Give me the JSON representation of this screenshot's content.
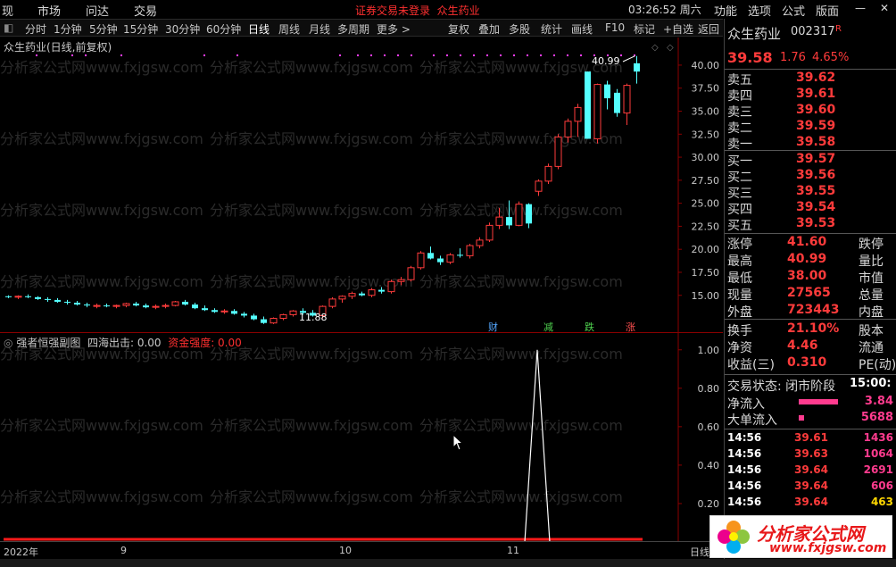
{
  "menubar": {
    "items": [
      "现",
      "市场",
      "问达",
      "交易"
    ],
    "status_warning": "证券交易未登录",
    "stock_name": "众生药业",
    "time": "03:26:52 周六",
    "right_items": [
      "功能",
      "选项",
      "公式",
      "版面"
    ]
  },
  "toolbar": {
    "items": [
      "分时",
      "1分钟",
      "5分钟",
      "15分钟",
      "30分钟",
      "60分钟",
      "日线",
      "周线",
      "月线",
      "多周期",
      "更多 >"
    ],
    "active": "日线",
    "right_items": [
      "复权",
      "叠加",
      "多股",
      "统计",
      "画线",
      "F10",
      "标记",
      "+自选",
      "返回"
    ]
  },
  "main_chart": {
    "title": "众生药业(日线,前复权)",
    "high_label": "40.99",
    "low_label": "11.88",
    "event_badges": [
      "财",
      "减",
      "跌",
      "涨"
    ]
  },
  "sub_chart": {
    "title": "强者恒强副图",
    "indicator1": "四海出击: 0.00",
    "indicator2": "资金强度: 0.00"
  },
  "date_axis": {
    "labels": [
      "2022年",
      "9",
      "10",
      "11"
    ],
    "period": "日线"
  },
  "watermark": "分析家公式网www.fxjgsw.com",
  "chart_data": [
    {
      "type": "candlestick",
      "title": "众生药业(日线,前复权)",
      "ylim": [
        11,
        43
      ],
      "y_ticks": [
        "40.00",
        "37.50",
        "35.00",
        "32.50",
        "30.00",
        "27.50",
        "25.00",
        "22.50",
        "20.00",
        "17.50",
        "15.00"
      ],
      "y_tick_values": [
        40,
        37.5,
        35,
        32.5,
        30,
        27.5,
        25,
        22.5,
        20,
        17.5,
        15
      ],
      "candles": [
        [
          14.9,
          15.0,
          14.7,
          14.8
        ],
        [
          14.8,
          15.0,
          14.6,
          14.9
        ],
        [
          14.9,
          15.1,
          14.7,
          14.8
        ],
        [
          14.8,
          14.9,
          14.5,
          14.6
        ],
        [
          14.6,
          14.8,
          14.3,
          14.5
        ],
        [
          14.5,
          14.7,
          14.2,
          14.3
        ],
        [
          14.3,
          14.5,
          14.0,
          14.2
        ],
        [
          14.2,
          14.4,
          13.9,
          14.0
        ],
        [
          14.0,
          14.2,
          13.7,
          13.9
        ],
        [
          13.8,
          14.1,
          13.6,
          13.9
        ],
        [
          13.9,
          14.1,
          13.7,
          13.8
        ],
        [
          13.8,
          14.0,
          13.6,
          13.9
        ],
        [
          13.9,
          14.2,
          13.7,
          14.1
        ],
        [
          14.1,
          14.3,
          13.8,
          13.9
        ],
        [
          13.9,
          14.1,
          13.6,
          13.7
        ],
        [
          13.7,
          14.0,
          13.5,
          13.8
        ],
        [
          13.8,
          14.1,
          13.6,
          13.9
        ],
        [
          13.9,
          14.4,
          13.8,
          14.3
        ],
        [
          14.3,
          14.5,
          13.9,
          14.0
        ],
        [
          14.0,
          14.2,
          13.5,
          13.6
        ],
        [
          13.6,
          13.9,
          13.3,
          13.4
        ],
        [
          13.4,
          13.6,
          13.1,
          13.2
        ],
        [
          13.2,
          13.5,
          13.0,
          13.3
        ],
        [
          13.3,
          13.5,
          12.9,
          13.0
        ],
        [
          13.0,
          13.2,
          12.6,
          12.8
        ],
        [
          12.8,
          13.0,
          12.3,
          12.4
        ],
        [
          12.4,
          12.7,
          11.9,
          12.0
        ],
        [
          12.0,
          12.6,
          11.88,
          12.5
        ],
        [
          12.5,
          13.0,
          12.3,
          12.9
        ],
        [
          12.9,
          13.4,
          12.7,
          13.3
        ],
        [
          13.3,
          13.6,
          12.9,
          13.1
        ],
        [
          13.1,
          13.4,
          12.7,
          12.8
        ],
        [
          12.8,
          13.9,
          12.5,
          13.8
        ],
        [
          13.8,
          14.8,
          13.6,
          14.6
        ],
        [
          14.6,
          15.0,
          14.2,
          14.9
        ],
        [
          14.9,
          15.4,
          14.6,
          15.2
        ],
        [
          15.2,
          15.4,
          14.9,
          15.0
        ],
        [
          15.0,
          15.8,
          14.8,
          15.6
        ],
        [
          15.6,
          15.9,
          15.2,
          15.4
        ],
        [
          15.4,
          16.7,
          15.2,
          16.5
        ],
        [
          16.5,
          17.0,
          16.1,
          16.7
        ],
        [
          16.7,
          18.2,
          16.5,
          18.0
        ],
        [
          18.0,
          19.8,
          17.8,
          19.6
        ],
        [
          19.6,
          20.3,
          18.9,
          19.0
        ],
        [
          19.0,
          19.3,
          18.3,
          18.6
        ],
        [
          18.6,
          19.6,
          18.4,
          19.4
        ],
        [
          19.4,
          20.1,
          19.1,
          19.3
        ],
        [
          19.3,
          20.6,
          19.0,
          20.4
        ],
        [
          20.4,
          21.3,
          20.1,
          21.0
        ],
        [
          21.0,
          22.9,
          20.8,
          22.6
        ],
        [
          22.6,
          24.5,
          22.2,
          23.5
        ],
        [
          23.5,
          25.3,
          22.2,
          22.6
        ],
        [
          22.6,
          25.2,
          22.5,
          24.9
        ],
        [
          24.9,
          25.0,
          22.3,
          22.8
        ],
        [
          26.3,
          27.6,
          25.8,
          27.4
        ],
        [
          27.4,
          29.3,
          27.1,
          29.0
        ],
        [
          29.0,
          32.5,
          28.7,
          32.2
        ],
        [
          32.2,
          34.2,
          31.6,
          33.9
        ],
        [
          33.9,
          35.8,
          32.2,
          35.4
        ],
        [
          39.3,
          39.3,
          32.0,
          32.0
        ],
        [
          32.0,
          38.0,
          31.5,
          37.9
        ],
        [
          37.9,
          38.3,
          35.2,
          36.4
        ],
        [
          37.0,
          37.4,
          34.4,
          34.8
        ],
        [
          34.8,
          38.0,
          33.5,
          37.8
        ],
        [
          40.2,
          40.99,
          38.0,
          39.3
        ]
      ]
    },
    {
      "type": "line",
      "title": "强者恒强副图",
      "series": [
        {
          "name": "四海出击",
          "values": [
            0,
            0,
            0,
            0,
            0,
            0,
            0,
            0,
            0,
            0,
            0,
            0,
            0,
            0,
            0,
            0,
            0,
            0,
            0,
            0,
            0,
            0,
            0,
            0,
            0,
            0,
            0,
            0,
            0,
            0,
            0,
            0,
            0,
            0,
            0,
            0,
            0,
            0,
            0,
            0,
            0,
            0,
            0,
            0,
            0,
            0,
            0,
            0,
            0,
            0,
            0,
            0,
            0,
            0,
            0,
            0,
            0,
            0,
            0,
            0,
            0,
            0,
            0,
            0,
            0
          ]
        },
        {
          "name": "资金强度",
          "values": [
            0,
            0,
            0,
            0,
            0,
            0,
            0,
            0,
            0,
            0,
            0,
            0,
            0,
            0,
            0,
            0,
            0,
            0,
            0,
            0,
            0,
            0,
            0,
            0,
            0,
            0,
            0,
            0,
            0,
            0,
            0,
            0,
            0,
            0,
            0,
            0,
            0,
            0,
            0,
            0,
            0,
            0,
            0,
            0,
            0,
            0,
            0,
            0,
            0,
            0,
            0,
            0,
            0,
            0,
            0,
            0,
            0,
            0,
            0,
            0,
            0,
            0,
            0,
            0,
            0
          ]
        }
      ],
      "spike": {
        "x_date": "2022-11",
        "value": 1.0
      },
      "ylim": [
        0,
        1.05
      ],
      "y_ticks": [
        "1.00",
        "0.80",
        "0.60",
        "0.40",
        "0.20"
      ],
      "y_tick_values": [
        1.0,
        0.8,
        0.6,
        0.4,
        0.2
      ]
    }
  ],
  "quote": {
    "name": "众生药业",
    "code": "002317",
    "flag": "R",
    "price": "39.58",
    "change": "1.76",
    "change_pct": "4.65%",
    "asks": [
      {
        "label": "卖五",
        "price": "39.62"
      },
      {
        "label": "卖四",
        "price": "39.61"
      },
      {
        "label": "卖三",
        "price": "39.60"
      },
      {
        "label": "卖二",
        "price": "39.59"
      },
      {
        "label": "卖一",
        "price": "39.58"
      }
    ],
    "bids": [
      {
        "label": "买一",
        "price": "39.57"
      },
      {
        "label": "买二",
        "price": "39.56"
      },
      {
        "label": "买三",
        "price": "39.55"
      },
      {
        "label": "买四",
        "price": "39.54"
      },
      {
        "label": "买五",
        "price": "39.53"
      }
    ],
    "stats": [
      {
        "label": "涨停",
        "value": "41.60",
        "right": "跌停"
      },
      {
        "label": "最高",
        "value": "40.99",
        "right": "量比"
      },
      {
        "label": "最低",
        "value": "38.00",
        "right": "市值"
      },
      {
        "label": "现量",
        "value": "27565",
        "right": "总量"
      },
      {
        "label": "外盘",
        "value": "723443",
        "right": "内盘"
      }
    ],
    "stats2": [
      {
        "label": "换手",
        "value": "21.10%",
        "right": "股本"
      },
      {
        "label": "净资",
        "value": "4.46",
        "right": "流通"
      },
      {
        "label": "收益(三)",
        "value": "0.310",
        "right": "PE(动)"
      }
    ],
    "trade_state_label": "交易状态: 闭市阶段",
    "trade_state_time": "15:00:",
    "net_inflow_label": "净流入",
    "net_inflow_value": "3.84",
    "big_inflow_label": "大单流入",
    "big_inflow_value": "5688",
    "ticks": [
      {
        "time": "14:56",
        "price": "39.61",
        "qty": "1436",
        "color": "#ff3b8e"
      },
      {
        "time": "14:56",
        "price": "39.63",
        "qty": "1064",
        "color": "#ff3b8e"
      },
      {
        "time": "14:56",
        "price": "39.64",
        "qty": "2691",
        "color": "#ff3b8e"
      },
      {
        "time": "14:56",
        "price": "39.64",
        "qty": "606",
        "color": "#ff3b8e"
      },
      {
        "time": "14:56",
        "price": "39.64",
        "qty": "463",
        "color": "#ffd700"
      }
    ]
  },
  "logo": {
    "text": "分析家公式网",
    "url_text": "www.fxjgsw.com"
  },
  "colors": {
    "up": "#ff3b3b",
    "down": "#54ffff",
    "bg": "#000000",
    "accent_red": "#e8181a"
  }
}
